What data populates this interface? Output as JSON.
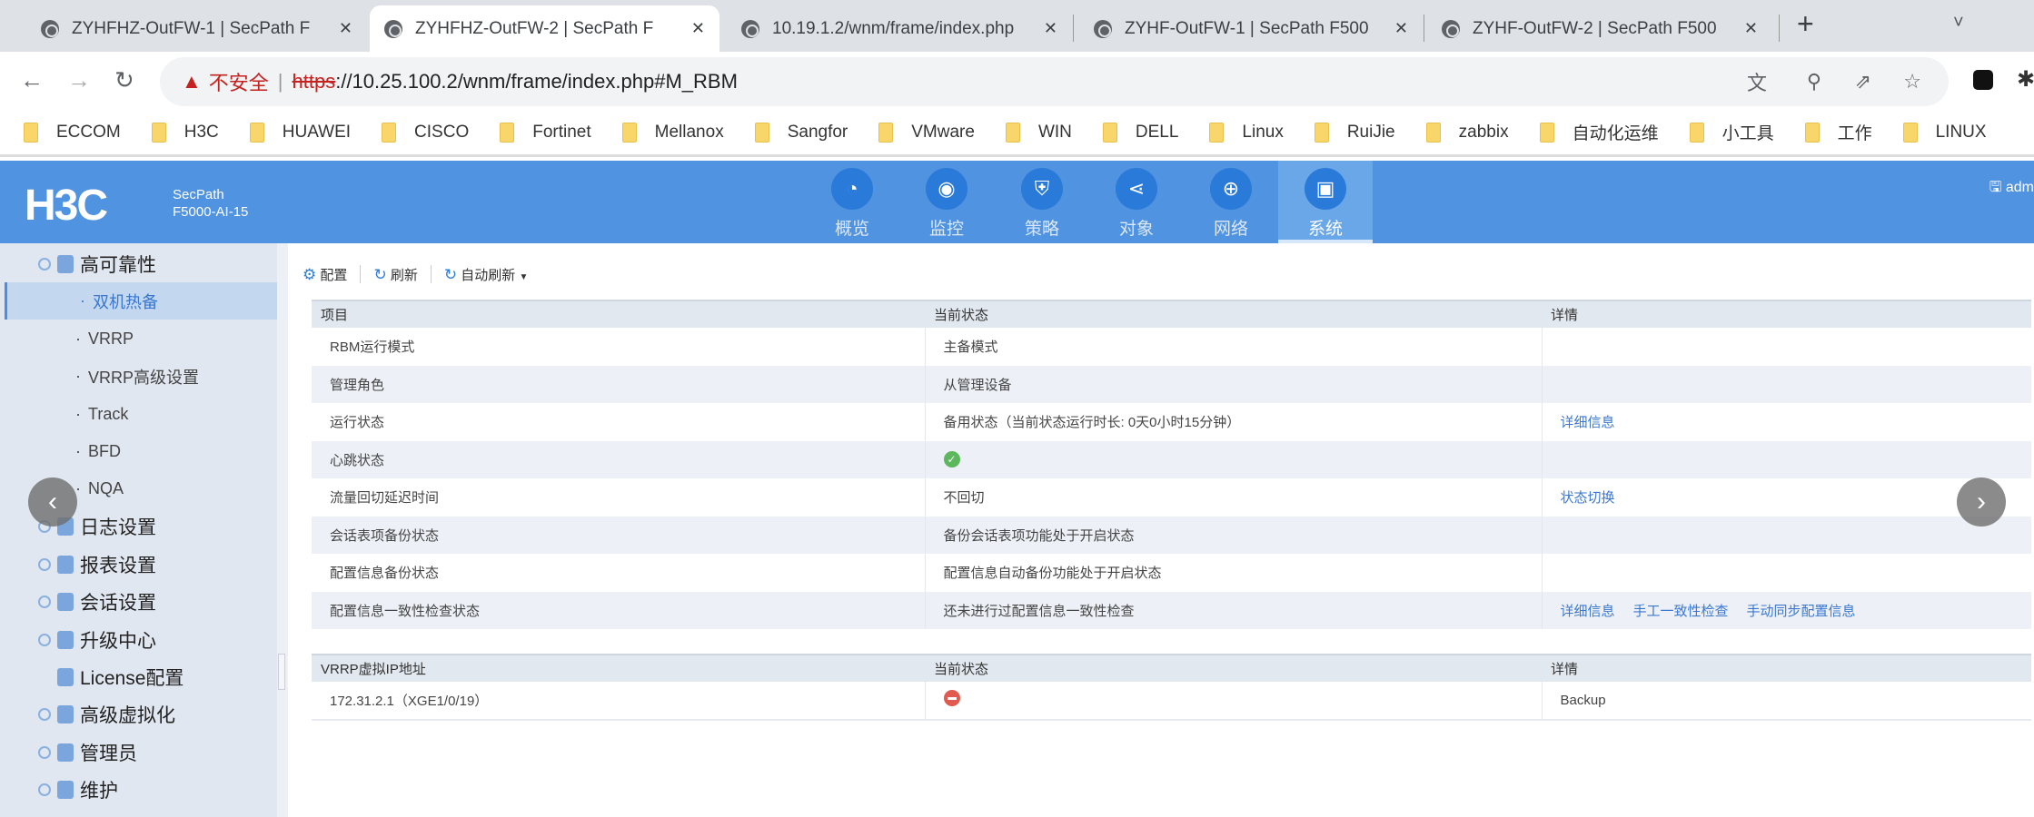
{
  "browser": {
    "tabs": [
      {
        "title": "ZYHFHZ-OutFW-1 | SecPath F"
      },
      {
        "title": "ZYHFHZ-OutFW-2 | SecPath F"
      },
      {
        "title": "10.19.1.2/wnm/frame/index.php"
      },
      {
        "title": "ZYHF-OutFW-1 | SecPath F500"
      },
      {
        "title": "ZYHF-OutFW-2 | SecPath F500"
      }
    ],
    "active_tab": 1,
    "new_tab": "+",
    "security_label": "不安全",
    "url_scheme": "https",
    "url_rest": "://10.25.100.2/wnm/frame/index.php#M_RBM",
    "bookmarks": [
      "ECCOM",
      "H3C",
      "HUAWEI",
      "CISCO",
      "Fortinet",
      "Mellanox",
      "Sangfor",
      "VMware",
      "WIN",
      "DELL",
      "Linux",
      "RuiJie",
      "zabbix",
      "自动化运维",
      "小工具",
      "工作",
      "LINUX"
    ]
  },
  "app": {
    "logo": "H3C",
    "product_line1": "SecPath",
    "product_line2": "F5000-AI-15",
    "user": "adm",
    "nav": [
      {
        "label": "概览",
        "icon": "dashboard-icon"
      },
      {
        "label": "监控",
        "icon": "monitor-icon"
      },
      {
        "label": "策略",
        "icon": "shield-icon"
      },
      {
        "label": "对象",
        "icon": "share-icon"
      },
      {
        "label": "网络",
        "icon": "globe-icon"
      },
      {
        "label": "系统",
        "icon": "screen-icon"
      }
    ],
    "active_nav": "系统",
    "accent": "#5093e0"
  },
  "sidebar": {
    "group": "高可靠性",
    "subitems": [
      "双机热备",
      "VRRP",
      "VRRP高级设置",
      "Track",
      "BFD",
      "NQA"
    ],
    "active": "双机热备",
    "groups": [
      "日志设置",
      "报表设置",
      "会话设置",
      "升级中心",
      "License配置",
      "高级虚拟化",
      "管理员",
      "维护"
    ]
  },
  "toolbar": {
    "config": "配置",
    "refresh": "刷新",
    "auto_refresh": "自动刷新"
  },
  "rbm_table": {
    "headers": [
      "项目",
      "当前状态",
      "详情"
    ],
    "rows": [
      {
        "item": "RBM运行模式",
        "status": "主备模式",
        "links": []
      },
      {
        "item": "管理角色",
        "status": "从管理设备",
        "links": []
      },
      {
        "item": "运行状态",
        "status": "备用状态（当前状态运行时长: 0天0小时15分钟）",
        "links": [
          "详细信息"
        ]
      },
      {
        "item": "心跳状态",
        "status": "",
        "status_icon": "ok",
        "links": []
      },
      {
        "item": "流量回切延迟时间",
        "status": "不回切",
        "links": [
          "状态切换"
        ]
      },
      {
        "item": "会话表项备份状态",
        "status": "备份会话表项功能处于开启状态",
        "links": []
      },
      {
        "item": "配置信息备份状态",
        "status": "配置信息自动备份功能处于开启状态",
        "links": []
      },
      {
        "item": "配置信息一致性检查状态",
        "status": "还未进行过配置信息一致性检查",
        "links": [
          "详细信息",
          "手工一致性检查",
          "手动同步配置信息"
        ]
      }
    ]
  },
  "vrrp_table": {
    "headers": [
      "VRRP虚拟IP地址",
      "当前状态",
      "详情"
    ],
    "rows": [
      {
        "ip": "172.31.2.1（XGE1/0/19）",
        "status_icon": "error",
        "detail": "Backup"
      }
    ]
  }
}
